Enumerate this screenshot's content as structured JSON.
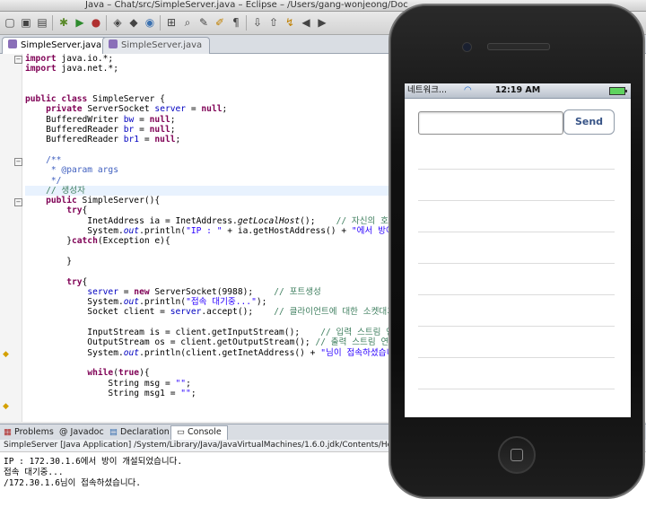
{
  "window": {
    "title": "Java – Chat/src/SimpleServer.java – Eclipse – /Users/gang-wonjeong/Doc"
  },
  "editor_tabs": [
    {
      "label": "SimpleServer.java",
      "active": true
    },
    {
      "label": "SimpleServer.java",
      "active": false
    }
  ],
  "code_lines": [
    {
      "parts": [
        {
          "c": "kw",
          "t": "import"
        },
        {
          "c": "",
          "t": " java.io.*;"
        }
      ]
    },
    {
      "parts": [
        {
          "c": "kw",
          "t": "import"
        },
        {
          "c": "",
          "t": " java.net.*;"
        }
      ]
    },
    {
      "parts": []
    },
    {
      "parts": []
    },
    {
      "parts": [
        {
          "c": "kw",
          "t": "public class"
        },
        {
          "c": "",
          "t": " SimpleServer {"
        }
      ]
    },
    {
      "parts": [
        {
          "c": "",
          "t": "    "
        },
        {
          "c": "kw",
          "t": "private"
        },
        {
          "c": "",
          "t": " ServerSocket "
        },
        {
          "c": "fld",
          "t": "server"
        },
        {
          "c": "",
          "t": " = "
        },
        {
          "c": "kw",
          "t": "null"
        },
        {
          "c": "",
          "t": ";"
        }
      ]
    },
    {
      "parts": [
        {
          "c": "",
          "t": "    BufferedWriter "
        },
        {
          "c": "fld",
          "t": "bw"
        },
        {
          "c": "",
          "t": " = "
        },
        {
          "c": "kw",
          "t": "null"
        },
        {
          "c": "",
          "t": ";"
        }
      ]
    },
    {
      "parts": [
        {
          "c": "",
          "t": "    BufferedReader "
        },
        {
          "c": "fld",
          "t": "br"
        },
        {
          "c": "",
          "t": " = "
        },
        {
          "c": "kw",
          "t": "null"
        },
        {
          "c": "",
          "t": ";"
        }
      ]
    },
    {
      "parts": [
        {
          "c": "",
          "t": "    BufferedReader "
        },
        {
          "c": "fld",
          "t": "br1"
        },
        {
          "c": "",
          "t": " = "
        },
        {
          "c": "kw",
          "t": "null"
        },
        {
          "c": "",
          "t": ";"
        }
      ]
    },
    {
      "parts": []
    },
    {
      "parts": [
        {
          "c": "jd",
          "t": "    /**"
        }
      ]
    },
    {
      "parts": [
        {
          "c": "jd",
          "t": "     * @param args"
        }
      ]
    },
    {
      "parts": [
        {
          "c": "jd",
          "t": "     */"
        }
      ]
    },
    {
      "hl": true,
      "parts": [
        {
          "c": "com",
          "t": "    // 생성자"
        }
      ]
    },
    {
      "parts": [
        {
          "c": "",
          "t": "    "
        },
        {
          "c": "kw",
          "t": "public"
        },
        {
          "c": "",
          "t": " SimpleServer(){"
        }
      ]
    },
    {
      "parts": [
        {
          "c": "",
          "t": "        "
        },
        {
          "c": "kw",
          "t": "try"
        },
        {
          "c": "",
          "t": "{"
        }
      ]
    },
    {
      "parts": [
        {
          "c": "",
          "t": "            InetAddress ia = InetAddress."
        },
        {
          "c": "it",
          "t": "getLocalHost"
        },
        {
          "c": "",
          "t": "();    "
        },
        {
          "c": "com",
          "t": "// 자신의 호스트 "
        }
      ]
    },
    {
      "parts": [
        {
          "c": "",
          "t": "            System."
        },
        {
          "c": "fld it",
          "t": "out"
        },
        {
          "c": "",
          "t": ".println("
        },
        {
          "c": "str",
          "t": "\"IP : \""
        },
        {
          "c": "",
          "t": " + ia.getHostAddress() + "
        },
        {
          "c": "str",
          "t": "\"에서 방이 개설"
        }
      ]
    },
    {
      "parts": [
        {
          "c": "",
          "t": "        }"
        },
        {
          "c": "kw",
          "t": "catch"
        },
        {
          "c": "",
          "t": "(Exception e){"
        }
      ]
    },
    {
      "parts": []
    },
    {
      "parts": [
        {
          "c": "",
          "t": "        }"
        }
      ]
    },
    {
      "parts": []
    },
    {
      "parts": [
        {
          "c": "",
          "t": "        "
        },
        {
          "c": "kw",
          "t": "try"
        },
        {
          "c": "",
          "t": "{"
        }
      ]
    },
    {
      "parts": [
        {
          "c": "",
          "t": "            "
        },
        {
          "c": "fld",
          "t": "server"
        },
        {
          "c": "",
          "t": " = "
        },
        {
          "c": "kw",
          "t": "new"
        },
        {
          "c": "",
          "t": " ServerSocket(9988);    "
        },
        {
          "c": "com",
          "t": "// 포트생성"
        }
      ]
    },
    {
      "parts": [
        {
          "c": "",
          "t": "            System."
        },
        {
          "c": "fld it",
          "t": "out"
        },
        {
          "c": "",
          "t": ".println("
        },
        {
          "c": "str",
          "t": "\"접속 대기중...\""
        },
        {
          "c": "",
          "t": ");"
        }
      ]
    },
    {
      "parts": [
        {
          "c": "",
          "t": "            Socket client = "
        },
        {
          "c": "fld",
          "t": "server"
        },
        {
          "c": "",
          "t": ".accept();    "
        },
        {
          "c": "com",
          "t": "// 클라이언트에 대한 소켓대기"
        }
      ]
    },
    {
      "parts": []
    },
    {
      "parts": [
        {
          "c": "",
          "t": "            InputStream is = client.getInputStream();    "
        },
        {
          "c": "com",
          "t": "// 입력 스트림 연결"
        }
      ]
    },
    {
      "parts": [
        {
          "c": "",
          "t": "            OutputStream os = client.getOutputStream(); "
        },
        {
          "c": "com",
          "t": "// 출력 스트림 연결"
        }
      ]
    },
    {
      "parts": [
        {
          "c": "",
          "t": "            System."
        },
        {
          "c": "fld it",
          "t": "out"
        },
        {
          "c": "",
          "t": ".println(client.getInetAddress() + "
        },
        {
          "c": "str",
          "t": "\"님이 접속하셨습니다.\""
        }
      ]
    },
    {
      "parts": []
    },
    {
      "parts": [
        {
          "c": "",
          "t": "            "
        },
        {
          "c": "kw",
          "t": "while"
        },
        {
          "c": "",
          "t": "("
        },
        {
          "c": "kw",
          "t": "true"
        },
        {
          "c": "",
          "t": "){"
        }
      ]
    },
    {
      "parts": [
        {
          "c": "",
          "t": "                String msg = "
        },
        {
          "c": "str",
          "t": "\"\""
        },
        {
          "c": "",
          "t": ";"
        }
      ]
    },
    {
      "parts": [
        {
          "c": "",
          "t": "                String msg1 = "
        },
        {
          "c": "str",
          "t": "\"\""
        },
        {
          "c": "",
          "t": ";"
        }
      ]
    }
  ],
  "bottom_tabs": [
    {
      "label": "Problems",
      "active": false
    },
    {
      "label": "Javadoc",
      "active": false
    },
    {
      "label": "Declaration",
      "active": false
    },
    {
      "label": "Console",
      "active": true
    }
  ],
  "console": {
    "header": "SimpleServer [Java Application] /System/Library/Java/JavaVirtualMachines/1.6.0.jdk/Contents/Home/bi",
    "lines": [
      "IP : 172.30.1.6에서 방이 개설되었습니다.",
      "접속 대기중...",
      "/172.30.1.6님이 접속하셨습니다."
    ]
  },
  "phone": {
    "carrier": "네트워크...",
    "time": "12:19 AM",
    "input_value": "",
    "send_label": "Send"
  },
  "colors": {
    "accent": "#385487",
    "status_bar": "#b9c1cc",
    "keyword": "#7f0055",
    "comment": "#3f7f5f",
    "string": "#2a00ff"
  }
}
